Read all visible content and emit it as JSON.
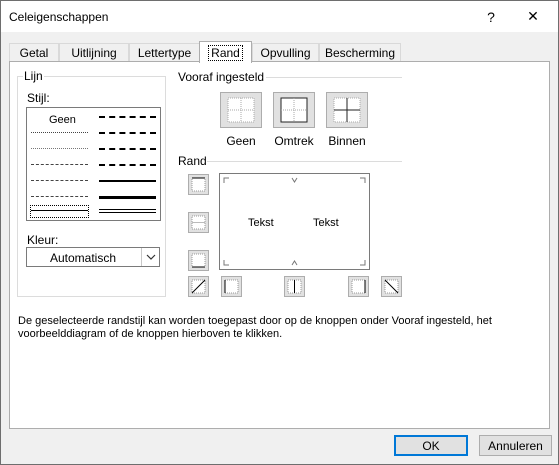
{
  "window": {
    "title": "Celeigenschappen",
    "help_label": "?",
    "close_label": "✕"
  },
  "tabs": [
    {
      "label": "Getal"
    },
    {
      "label": "Uitlijning"
    },
    {
      "label": "Lettertype"
    },
    {
      "label": "Rand",
      "active": true
    },
    {
      "label": "Opvulling"
    },
    {
      "label": "Bescherming"
    }
  ],
  "line_group": {
    "title": "Lijn",
    "style_label": "Stijl:",
    "none_label": "Geen",
    "color_label": "Kleur:",
    "color_value": "Automatisch"
  },
  "presets": {
    "title": "Vooraf ingesteld",
    "items": [
      {
        "label": "Geen"
      },
      {
        "label": "Omtrek"
      },
      {
        "label": "Binnen"
      }
    ]
  },
  "border": {
    "title": "Rand",
    "preview_text": [
      "Tekst",
      "Tekst"
    ]
  },
  "description": "De geselecteerde randstijl kan worden toegepast door op de knoppen onder Vooraf ingesteld, het voorbeelddiagram of de knoppen hierboven te klikken.",
  "buttons": {
    "ok": "OK",
    "cancel": "Annuleren"
  },
  "colors": {
    "accent": "#0078d7",
    "panel_bg": "#ffffff",
    "window_bg": "#f0f0f0"
  }
}
